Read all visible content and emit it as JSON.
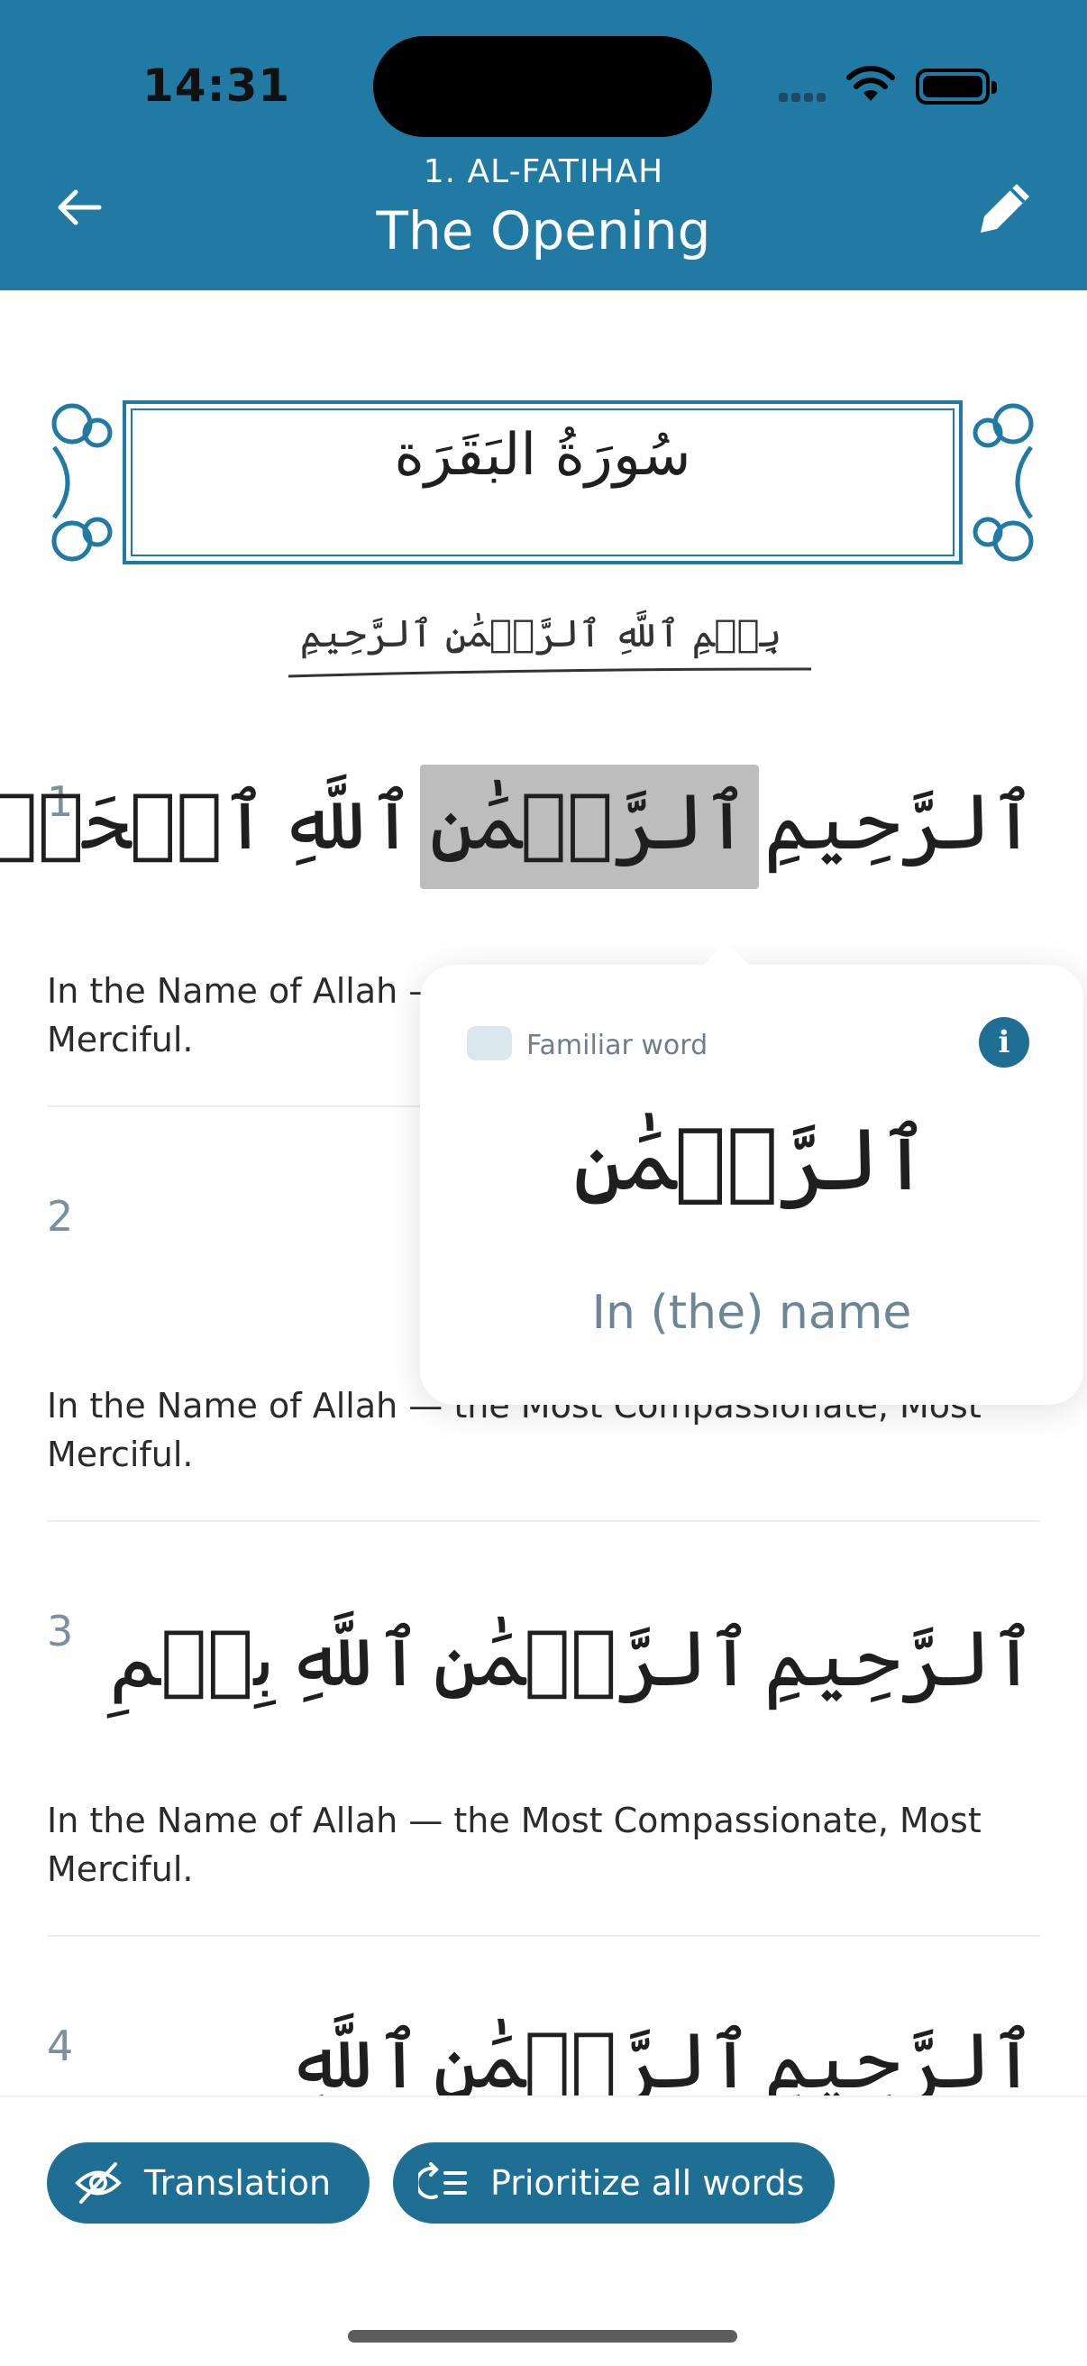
{
  "status_bar": {
    "time": "14:31"
  },
  "header": {
    "surah_number_name": "1. AL-FATIHAH",
    "title": "The Opening"
  },
  "surah_banner": {
    "name": "سُورَةُ البَقَرَة"
  },
  "basmala": {
    "text": "بِسۡمِ ٱللَّهِ ٱلرَّحۡمَٰنِ ٱلرَّحِيمِ"
  },
  "verses": [
    {
      "number": "1",
      "words": [
        "ٱلرَّحِيمِ",
        "ٱلرَّحۡمَٰنِ",
        "ٱللَّهِ",
        "ٱلۡحَمۡدُ"
      ],
      "highlighted_index": 1,
      "translation": "In the Name of Allah — the Most Compassionate, Most Merciful."
    },
    {
      "number": "2",
      "translation": "In the Name of Allah — the Most Compassionate, Most Merciful."
    },
    {
      "number": "3",
      "words": [
        "ٱلرَّحِيمِ",
        "ٱلرَّحۡمَٰنِ",
        "ٱللَّهِ",
        "بِسۡمِ"
      ],
      "translation": "In the Name of Allah — the Most Compassionate, Most Merciful."
    },
    {
      "number": "4",
      "words": [
        "ٱلرَّحِيمِ",
        "ٱلرَّحۡمَٰنِ",
        "ٱللَّهِ"
      ]
    }
  ],
  "popup": {
    "familiar_label": "Familiar word",
    "familiar_checked": false,
    "info_icon": "i",
    "arabic": "ٱلرَّحۡمَٰنِ",
    "meaning": "In (the) name"
  },
  "bottom_bar": {
    "translation_label": "Translation",
    "prioritize_label": "Prioritize all words"
  },
  "colors": {
    "primary": "#217aa3",
    "button": "#1f6e94",
    "highlight": "#bdbdbd",
    "muted_text": "#7b8f9c"
  }
}
